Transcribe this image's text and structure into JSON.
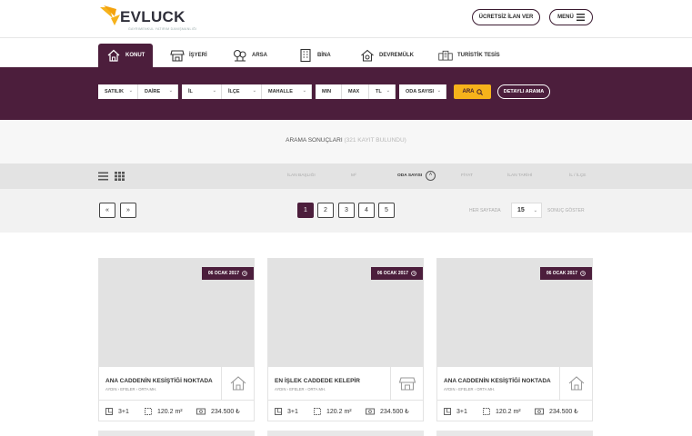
{
  "brand": {
    "name": "EVLUCK",
    "tagline": "GAYRIMENKUL YATIRIM DANIŞMANLIĞI",
    "accent": "#4c1e3c",
    "highlight": "#f6b21b"
  },
  "header": {
    "post_listing": "ÜCRETSİZ İLAN VER",
    "menu": "MENÜ"
  },
  "tabs": [
    {
      "label": "KONUT",
      "icon": "house-icon",
      "active": true
    },
    {
      "label": "İŞYERİ",
      "icon": "store-icon"
    },
    {
      "label": "ARSA",
      "icon": "trees-icon"
    },
    {
      "label": "BİNA",
      "icon": "building-icon"
    },
    {
      "label": "DEVREMÜLK",
      "icon": "timeshare-icon"
    },
    {
      "label": "TURİSTİK TESİS",
      "icon": "hotel-icon"
    }
  ],
  "search": {
    "status": "SATILIK",
    "type": "DAİRE",
    "province": "İL",
    "district": "İLÇE",
    "neighborhood": "MAHALLE",
    "min": "MIN",
    "max": "MAX",
    "currency": "TL",
    "rooms": "ODA SAYISI",
    "search_button": "ARA",
    "advanced_button": "DETAYLI ARAMA"
  },
  "results": {
    "title": "ARAMA SONUÇLARI",
    "count": "(321 KAYIT BULUNDU)"
  },
  "sort": {
    "columns": [
      "İLAN BAŞLIĞI",
      "M²",
      "ODA SAYISI",
      "FİYAT",
      "İLAN TARİHİ",
      "İL / İLÇE"
    ],
    "active": "ODA SAYISI"
  },
  "pager": {
    "first": "«",
    "prev": "»",
    "pages": [
      "1",
      "2",
      "3",
      "4",
      "5"
    ],
    "current": "1",
    "per_page_label": "HER SAYFADA",
    "per_page_value": "15",
    "per_page_suffix": "SONUÇ GÖSTER"
  },
  "listings": [
    {
      "date": "06 OCAK 2017",
      "title": "ANA CADDENİN KESİŞTİĞİ NOKTADA",
      "location": [
        "AYDIN",
        "EFELER",
        "ORTA MH."
      ],
      "type_icon": "house-icon",
      "rooms": "3+1",
      "area": "120.2 m²",
      "price": "234.500 ₺"
    },
    {
      "date": "06 OCAK 2017",
      "title": "EN İŞLEK CADDEDE KELEPİR",
      "location": [
        "AYDIN",
        "EFELER",
        "ORTA MH."
      ],
      "type_icon": "store-icon",
      "rooms": "3+1",
      "area": "120.2 m²",
      "price": "234.500 ₺"
    },
    {
      "date": "06 OCAK 2017",
      "title": "ANA CADDENİN KESİŞTİĞİ NOKTADA",
      "location": [
        "AYDIN",
        "EFELER",
        "ORTA MH."
      ],
      "type_icon": "house-icon",
      "rooms": "3+1",
      "area": "120.2 m²",
      "price": "234.500 ₺"
    }
  ]
}
